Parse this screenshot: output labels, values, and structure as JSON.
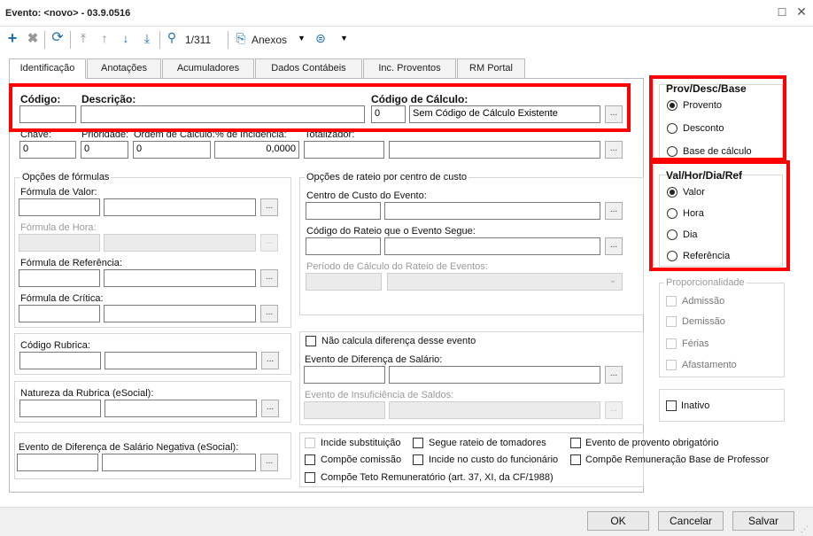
{
  "window": {
    "title": "Evento: <novo> - 03.9.0516"
  },
  "toolbar": {
    "record_pos": "1/311",
    "anexos_label": "Anexos"
  },
  "tabs": [
    "Identificação",
    "Anotações",
    "Acumuladores",
    "Dados Contábeis",
    "Inc. Proventos",
    "RM Portal"
  ],
  "header": {
    "codigo_label": "Código:",
    "descricao_label": "Descrição:",
    "calc_label": "Código de Cálculo:",
    "calc_code": "0",
    "calc_desc": "Sem Código de Cálculo Existente"
  },
  "row2": {
    "chave_label": "Chave:",
    "chave_value": "0",
    "prioridade_label": "Prioridade:",
    "prioridade_value": "0",
    "ordem_label": "Ordem de Cálculo:",
    "ordem_value": "0",
    "incidencia_label": "% de Incidência:",
    "incidencia_value": "0,0000",
    "totalizador_label": "Totalizador:"
  },
  "formulas": {
    "title": "Opções de fórmulas",
    "valor_label": "Fórmula de Valor:",
    "hora_label": "Fórmula de Hora:",
    "referencia_label": "Fórmula de Referência:",
    "critica_label": "Fórmula de Crítica:"
  },
  "rateio": {
    "title": "Opções de rateio por centro de custo",
    "centro_label": "Centro de Custo do Evento:",
    "codigo_rateio_label": "Código do Rateio que o Evento Segue:",
    "periodo_label": "Período de Cálculo do Rateio de Eventos:"
  },
  "rubrica": {
    "label": "Código Rubrica:"
  },
  "natureza": {
    "label": "Natureza da Rubrica (eSocial):"
  },
  "negativa": {
    "label": "Evento de Diferença de Salário Negativa (eSocial):"
  },
  "diferenca": {
    "nao_calcula_label": "Não calcula diferença desse evento",
    "evento_dif_label": "Evento de Diferença de Salário:",
    "insuficiencia_label": "Evento de Insuficiência de Saldos:"
  },
  "checks": {
    "incide_substituicao": "Incide substituição",
    "segue_rateio": "Segue rateio de tomadores",
    "provento_obrigatorio": "Evento de provento obrigatório",
    "compoe_comissao": "Compõe comissão",
    "incide_custo": "Incide no custo do funcionário",
    "compoe_remuneracao": "Compõe Remuneração Base de Professor",
    "compoe_teto": "Compõe Teto Remuneratório (art. 37, XI, da CF/1988)"
  },
  "prov": {
    "title": "Prov/Desc/Base",
    "options": [
      "Provento",
      "Desconto",
      "Base de cálculo"
    ],
    "selected": "Provento"
  },
  "val": {
    "title": "Val/Hor/Dia/Ref",
    "options": [
      "Valor",
      "Hora",
      "Dia",
      "Referência"
    ],
    "selected": "Valor"
  },
  "proporcionalidade": {
    "title": "Proporcionalidade",
    "options": [
      "Admissão",
      "Demissão",
      "Férias",
      "Afastamento"
    ]
  },
  "inativo": {
    "label": "Inativo"
  },
  "buttons": {
    "ok": "OK",
    "cancelar": "Cancelar",
    "salvar": "Salvar"
  },
  "colors": {
    "highlight": "#ff0000",
    "accent": "#1f6fb5"
  }
}
